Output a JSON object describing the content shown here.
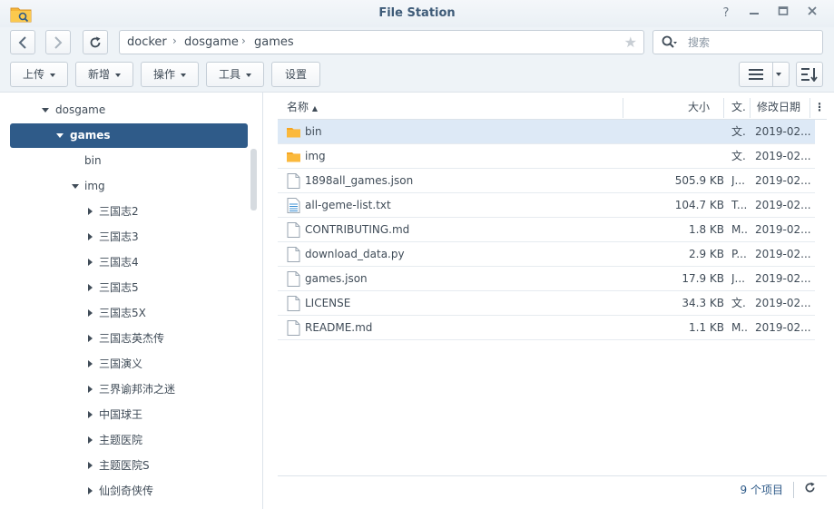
{
  "window": {
    "title": "File Station",
    "buttons": [
      "?",
      "—",
      "□",
      "✕"
    ]
  },
  "nav": {
    "back_icon": "chevron-left-icon",
    "forward_icon": "chevron-right-icon",
    "refresh_icon": "refresh-icon",
    "breadcrumb": [
      "docker",
      "dosgame",
      "games"
    ],
    "favorite_icon": "star-icon"
  },
  "search": {
    "placeholder": "搜索"
  },
  "toolbar": {
    "upload_label": "上传",
    "create_label": "新增",
    "action_label": "操作",
    "tools_label": "工具",
    "settings_label": "设置"
  },
  "tree": {
    "items": [
      {
        "label": "dosgame"
      },
      {
        "label": "games"
      },
      {
        "label": "bin"
      },
      {
        "label": "img"
      },
      {
        "label": "三国志2"
      },
      {
        "label": "三国志3"
      },
      {
        "label": "三国志4"
      },
      {
        "label": "三国志5"
      },
      {
        "label": "三国志5X"
      },
      {
        "label": "三国志英杰传"
      },
      {
        "label": "三国演义"
      },
      {
        "label": "三界谕邦沛之迷"
      },
      {
        "label": "中国球王"
      },
      {
        "label": "主题医院"
      },
      {
        "label": "主题医院S"
      },
      {
        "label": "仙剑奇侠传"
      }
    ]
  },
  "list": {
    "columns": {
      "name": "名称",
      "size": "大小",
      "type": "文.",
      "modified": "修改日期"
    },
    "rows": [
      {
        "name": "bin",
        "size": "",
        "type": "文.",
        "modified": "2019-02..."
      },
      {
        "name": "img",
        "size": "",
        "type": "文.",
        "modified": "2019-02..."
      },
      {
        "name": "1898all_games.json",
        "size": "505.9 KB",
        "type": "J...",
        "modified": "2019-02..."
      },
      {
        "name": "all-geme-list.txt",
        "size": "104.7 KB",
        "type": "T...",
        "modified": "2019-02..."
      },
      {
        "name": "CONTRIBUTING.md",
        "size": "1.8 KB",
        "type": "M...",
        "modified": "2019-02..."
      },
      {
        "name": "download_data.py",
        "size": "2.9 KB",
        "type": "P...",
        "modified": "2019-02..."
      },
      {
        "name": "games.json",
        "size": "17.9 KB",
        "type": "J...",
        "modified": "2019-02..."
      },
      {
        "name": "LICENSE",
        "size": "34.3 KB",
        "type": "文.",
        "modified": "2019-02..."
      },
      {
        "name": "README.md",
        "size": "1.1 KB",
        "type": "M...",
        "modified": "2019-02..."
      }
    ]
  },
  "footer": {
    "item_count": "9 个项目"
  },
  "colors": {
    "accent": "#2f5b89",
    "folder": "#f5a623",
    "selected_row": "#dde9f6"
  }
}
